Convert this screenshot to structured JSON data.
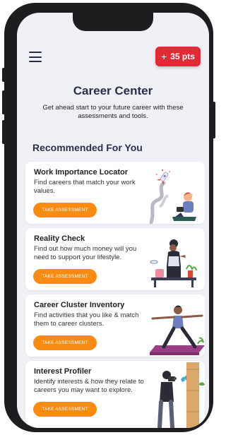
{
  "header": {
    "points_label": "35 pts",
    "plus_icon": "plus-icon",
    "menu_icon": "hamburger-menu-icon"
  },
  "page": {
    "title": "Career Center",
    "subtitle": "Get ahead start to your future career with these assessments and tools.",
    "section_heading": "Recommended For You"
  },
  "cards": [
    {
      "title": "Work Importance Locator",
      "description": "Find careers that match your work values.",
      "button_label": "TAKE ASSESSMENT",
      "illustration": "person-with-rocket-illustration"
    },
    {
      "title": "Reality Check",
      "description": "Find out how much money will you need to support your lifestyle.",
      "button_label": "TAKE ASSESSMENT",
      "illustration": "person-with-table-illustration"
    },
    {
      "title": "Career Cluster Inventory",
      "description": "Find activities that you like & match them to career clusters.",
      "button_label": "TAKE ASSESSMENT",
      "illustration": "person-doing-yoga-illustration"
    },
    {
      "title": "Interest Profiler",
      "description": "Identify interests & how they relate to careers you may want to explore.",
      "button_label": "TAKE ASSESSMENT",
      "illustration": "person-with-camera-illustration"
    }
  ],
  "colors": {
    "accent_red": "#e22a37",
    "accent_orange": "#f98a12",
    "heading": "#2b2f4c",
    "background": "#f0f1f6"
  }
}
